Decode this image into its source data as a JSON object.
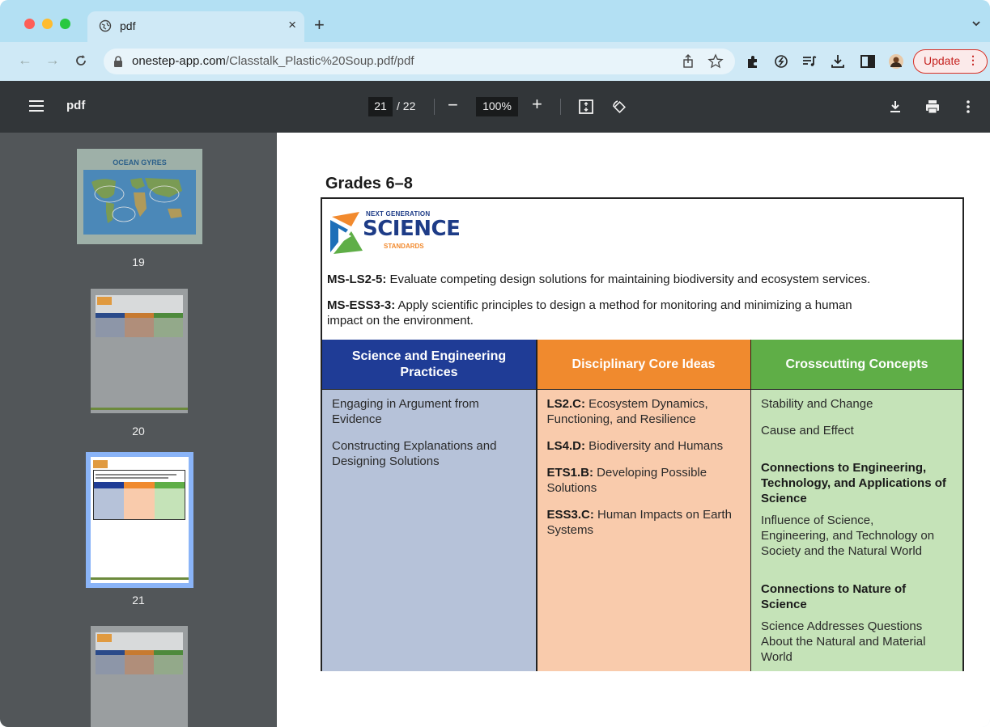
{
  "browser": {
    "tab_title": "pdf",
    "url_host": "onestep-app.com",
    "url_path": "/Classtalk_Plastic%20Soup.pdf/pdf",
    "update_label": "Update"
  },
  "pdf_toolbar": {
    "file_name": "pdf",
    "current_page": "21",
    "total_pages": "/ 22",
    "zoom": "100%"
  },
  "sidebar": {
    "thumbnails": [
      {
        "page": "19",
        "title": "OCEAN GYRES"
      },
      {
        "page": "20"
      },
      {
        "page": "21"
      },
      {
        "page": ""
      }
    ]
  },
  "document": {
    "heading": "Grades 6–8",
    "logo": {
      "line1": "NEXT GENERATION",
      "line2": "SCIENCE",
      "line3": "STANDARDS"
    },
    "standards": [
      {
        "code": "MS-LS2-5:",
        "text": " Evaluate competing design solutions for maintaining biodiversity and ecosystem services."
      },
      {
        "code": "MS-ESS3-3:",
        "text": " Apply scientific principles to design a method for monitoring and minimizing a human"
      },
      {
        "code": "",
        "text": "impact on the environment."
      }
    ],
    "columns": {
      "sep": {
        "header_line1": "Science and Engineering",
        "header_line2": "Practices",
        "items": [
          "Engaging in Argument from",
          "Evidence",
          "Constructing Explanations and",
          "Designing Solutions"
        ]
      },
      "dci": {
        "header": "Disciplinary Core Ideas",
        "items": [
          {
            "code": "LS2.C:",
            "text": " Ecosystem Dynamics,",
            "cont": "Functioning, and Resilience"
          },
          {
            "code": "LS4.D:",
            "text": " Biodiversity and Humans",
            "cont": ""
          },
          {
            "code": "ETS1.B:",
            "text": " Developing Possible",
            "cont": "Solutions"
          },
          {
            "code": "ESS3.C:",
            "text": " Human Impacts on Earth",
            "cont": "Systems"
          }
        ]
      },
      "ccc": {
        "header": "Crosscutting Concepts",
        "items": [
          "Stability and Change",
          "Cause and Effect"
        ],
        "eng_heading": [
          "Connections to Engineering,",
          "Technology, and Applications of",
          "Science"
        ],
        "eng_body": [
          "Influence of Science,",
          "Engineering, and Technology on",
          "Society and the Natural World"
        ],
        "nos_heading": [
          "Connections to Nature of",
          "Science"
        ],
        "nos_body": [
          "Science Addresses Questions",
          "About the Natural and Material",
          "World"
        ]
      }
    },
    "colors": {
      "sep_header": "#1f3c96",
      "sep_body": "#b6c2d9",
      "dci_header": "#f08a2e",
      "dci_body": "#f9cbac",
      "ccc_header": "#5fae47",
      "ccc_body": "#c5e3b8"
    }
  }
}
